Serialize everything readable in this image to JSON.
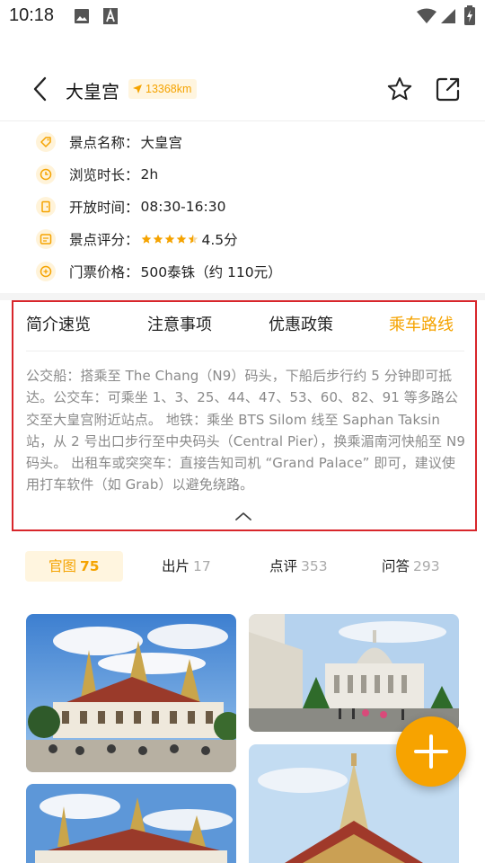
{
  "status_bar": {
    "time": "10:18"
  },
  "header": {
    "title": "大皇宫",
    "distance": "13368km"
  },
  "info": [
    {
      "icon": "tag-icon",
      "label": "景点名称：",
      "value": "大皇宫"
    },
    {
      "icon": "clock-icon",
      "label": "浏览时长：",
      "value": "2h"
    },
    {
      "icon": "door-icon",
      "label": "开放时间：",
      "value": "08:30-16:30"
    },
    {
      "icon": "rating-icon",
      "label": "景点评分：",
      "value": "4.5分",
      "rating": 4.5
    },
    {
      "icon": "ticket-icon",
      "label": "门票价格：",
      "value": "500泰铢（约 110元）"
    }
  ],
  "tabs": [
    {
      "label": "简介速览",
      "active": false
    },
    {
      "label": "注意事项",
      "active": false
    },
    {
      "label": "优惠政策",
      "active": false
    },
    {
      "label": "乘车路线",
      "active": true
    }
  ],
  "route_text": "公交船：搭乘至 The Chang（N9）码头，下船后步行约 5 分钟即可抵达。公交车：可乘坐 1、3、25、44、47、53、60、82、91 等多路公交至大皇宫附近站点。 地铁：乘坐 BTS Silom 线至 Saphan Taksin 站，从 2 号出口步行至中央码头（Central Pier），换乘湄南河快船至 N9 码头。 出租车或突突车：直接告知司机 “Grand Palace” 即可，建议使用打车软件（如 Grab）以避免绕路。",
  "photo_tabs": [
    {
      "label": "官图",
      "count": "75",
      "active": true
    },
    {
      "label": "出片",
      "count": "17",
      "active": false
    },
    {
      "label": "点评",
      "count": "353",
      "active": false
    },
    {
      "label": "问答",
      "count": "293",
      "active": false
    }
  ],
  "colors": {
    "accent": "#f5a300",
    "highlight_border": "#d8262b",
    "muted_text": "#8a8a8a"
  }
}
